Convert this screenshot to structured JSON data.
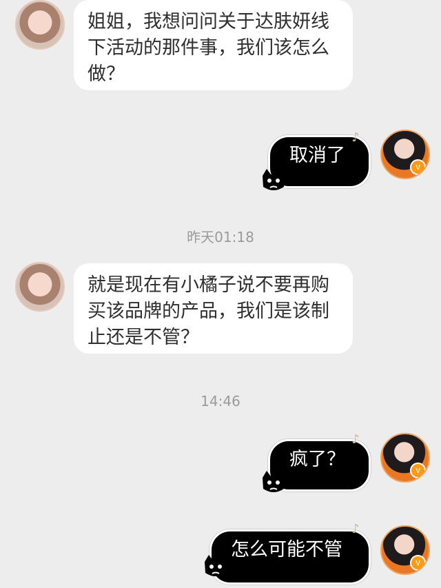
{
  "messages": [
    {
      "text": "姐姐，我想问问关于达肤妍线下活动的那件事，我们该怎么做？"
    },
    {
      "text": "取消了"
    },
    {
      "text": "就是现在有小橘子说不要再购买该品牌的产品，我们是该制止还是不管？"
    },
    {
      "text": "疯了？"
    },
    {
      "text": "怎么可能不管"
    }
  ],
  "timestamps": [
    "昨天01:18",
    "14:46"
  ],
  "icons": {
    "verified": "v",
    "music": "♪",
    "cat": "cat-decoration-icon"
  }
}
